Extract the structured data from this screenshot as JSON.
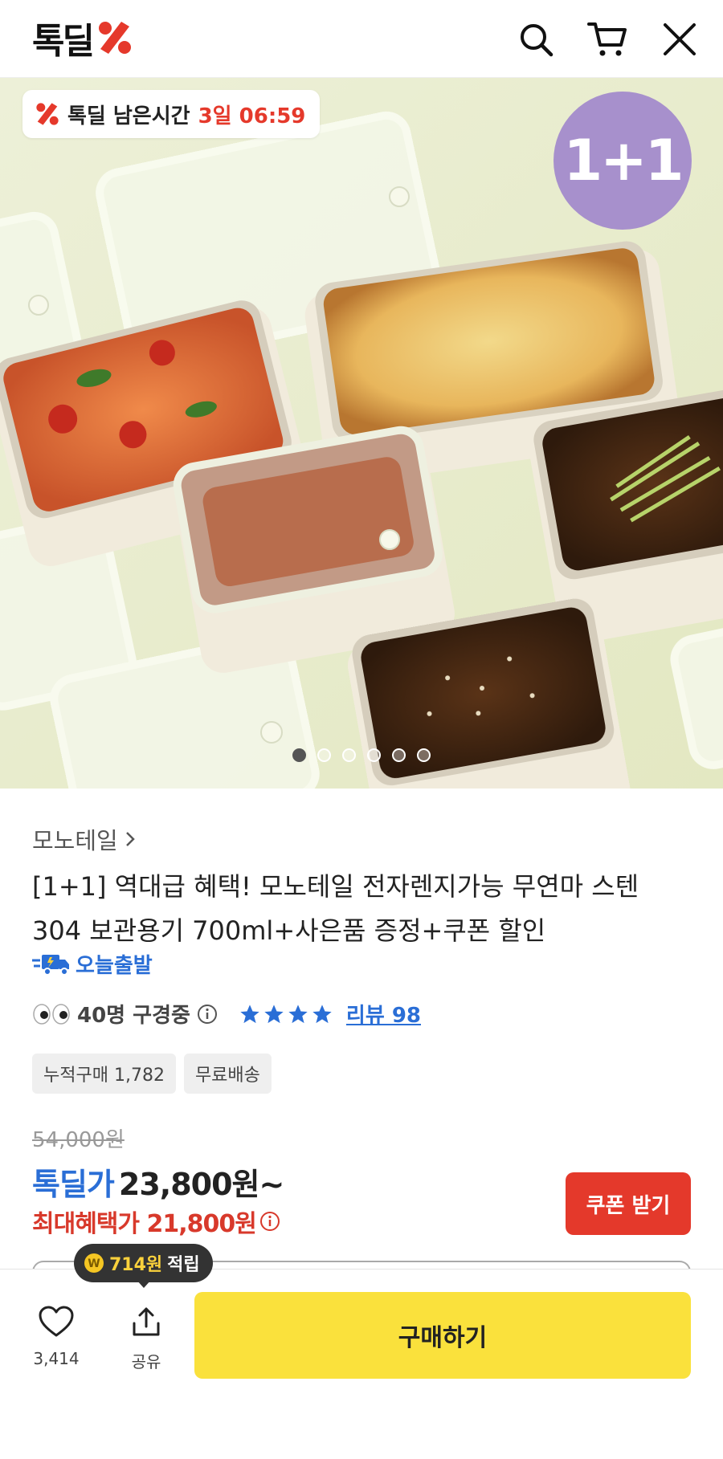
{
  "header": {
    "logo_text": "톡딜",
    "icons": [
      "search-icon",
      "cart-icon",
      "close-icon"
    ]
  },
  "hero": {
    "timer_label": "톡딜 남은시간",
    "timer_value": "3일 06:59",
    "promo_badge": "1+1",
    "carousel": {
      "total": 6,
      "active": 1
    }
  },
  "product": {
    "brand": "모노테일",
    "title": "[1+1] 역대급 혜택! 모노테일 전자렌지가능 무연마 스텐 304 보관용기 700ml+사은품 증정+쿠폰 할인",
    "delivery_badge": "오늘출발",
    "viewers": "40명 구경중",
    "rating_stars": 4,
    "review_link": "리뷰 98",
    "tags": [
      "누적구매 1,782",
      "무료배송"
    ],
    "original_price": "54,000원",
    "deal_label": "톡딜가",
    "deal_price": "23,800원~",
    "max_benefit": "최대혜택가 21,800원",
    "coupon_button": "쿠폰 받기"
  },
  "bottom": {
    "points_value": "714원",
    "points_suffix": "적립",
    "like_count": "3,414",
    "share_label": "공유",
    "buy_button": "구매하기"
  },
  "colors": {
    "accent_red": "#e5392b",
    "deal_blue": "#2a6ed6",
    "badge_purple": "#a790cc",
    "buy_yellow": "#fae13c"
  }
}
